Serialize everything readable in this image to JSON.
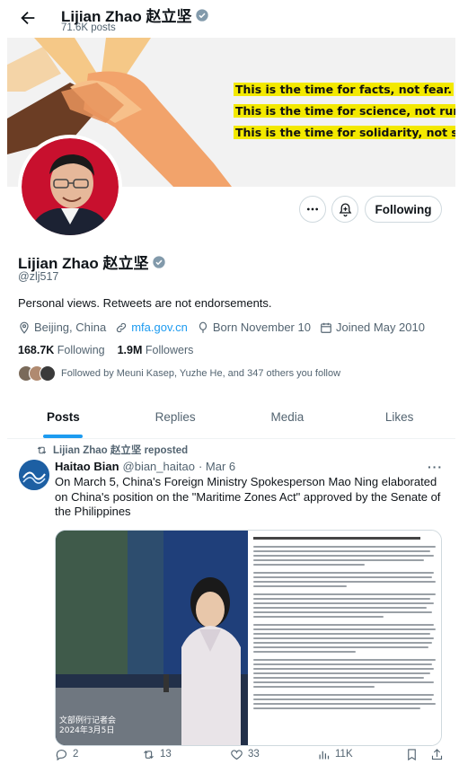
{
  "header": {
    "name": "Lijian Zhao 赵立坚",
    "posts_count": "71.6K posts"
  },
  "banner": {
    "lines": [
      "This is the time for facts, not fear.",
      "This is the time for science, not rumors.",
      "This is the time for solidarity, not stigma."
    ],
    "highlight_color": "#f3e900"
  },
  "actions": {
    "following_label": "Following"
  },
  "profile": {
    "name": "Lijian Zhao 赵立坚",
    "handle": "@zlj517",
    "bio": "Personal views. Retweets are not endorsements.",
    "location": "Beijing, China",
    "website": "mfa.gov.cn",
    "birth": "Born November 10",
    "joined": "Joined May 2010",
    "following_count": "168.7K",
    "following_label": "Following",
    "followers_count": "1.9M",
    "followers_label": "Followers",
    "followed_by": "Followed by Meuni Kasep, Yuzhe He, and 347 others you follow"
  },
  "tabs": [
    "Posts",
    "Replies",
    "Media",
    "Likes"
  ],
  "post": {
    "repost_label": "Lijian Zhao 赵立坚 reposted",
    "author_name": "Haitao Bian",
    "author_handle": "@bian_haitao",
    "date": "· Mar 6",
    "text": "On March 5, China's Foreign Ministry Spokesperson Mao Ning elaborated on China's position on the \"Maritime Zones Act\" approved by the Senate of the Philippines",
    "media_caption_1": "文部例行记者会",
    "media_caption_2": "2024年3月5日",
    "replies": "2",
    "reposts": "13",
    "likes": "33",
    "views": "11K"
  },
  "colors": {
    "accent": "#1d9bf0",
    "verified": "#829aab",
    "muted": "#536471"
  }
}
